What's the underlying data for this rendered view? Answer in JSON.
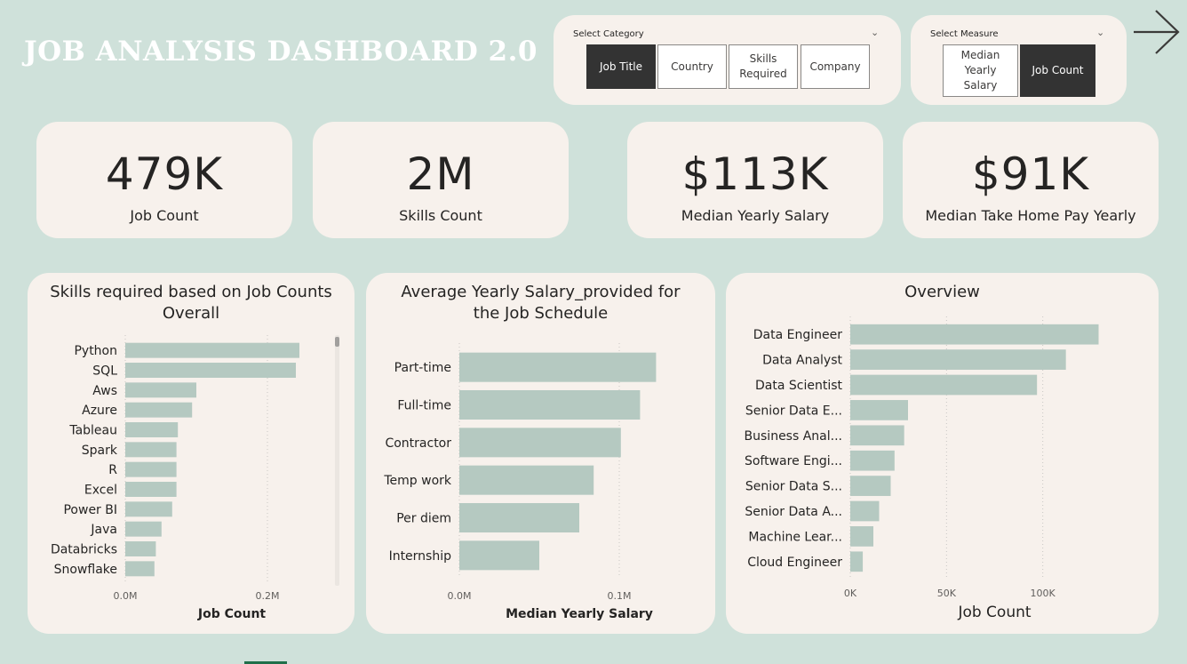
{
  "title": "JOB ANALYSIS DASHBOARD 2.0",
  "category_slicer": {
    "label": "Select Category",
    "options": [
      {
        "label": "Job Title",
        "selected": true
      },
      {
        "label": "Country",
        "selected": false
      },
      {
        "label": "Skills Required",
        "selected": false
      },
      {
        "label": "Company",
        "selected": false
      }
    ]
  },
  "measure_slicer": {
    "label": "Select Measure",
    "options": [
      {
        "label": "Median Yearly Salary",
        "selected": false
      },
      {
        "label": "Job Count",
        "selected": true
      }
    ]
  },
  "kpis": [
    {
      "value": "479K",
      "label": "Job Count"
    },
    {
      "value": "2M",
      "label": "Skills Count"
    },
    {
      "value": "$113K",
      "label": "Median Yearly Salary"
    },
    {
      "value": "$91K",
      "label": "Median Take Home Pay Yearly"
    }
  ],
  "colors": {
    "background": "#cfe1da",
    "card": "#f7f1ec",
    "bar": "#b5c9c1",
    "selected_tile": "#333333",
    "title_text": "#ffffff"
  },
  "chart_data": [
    {
      "type": "bar",
      "orientation": "horizontal",
      "title": "Skills required based on Job Counts Overall",
      "categories": [
        "Python",
        "SQL",
        "Aws",
        "Azure",
        "Tableau",
        "Spark",
        "R",
        "Excel",
        "Power BI",
        "Java",
        "Databricks",
        "Snowflake"
      ],
      "values": [
        245000,
        240000,
        100000,
        94000,
        74000,
        72000,
        72000,
        72000,
        66000,
        51000,
        43000,
        41000
      ],
      "xlabel": "Job Count",
      "ylabel": "",
      "xlim": [
        0,
        300000
      ],
      "xticks": [
        0,
        200000
      ],
      "xtick_labels": [
        "0.0M",
        "0.2M"
      ],
      "grid": true
    },
    {
      "type": "bar",
      "orientation": "horizontal",
      "title": "Average Yearly Salary_provided for the Job Schedule",
      "categories": [
        "Part-time",
        "Full-time",
        "Contractor",
        "Temp work",
        "Per diem",
        "Internship"
      ],
      "values": [
        123000,
        113000,
        101000,
        84000,
        75000,
        50000
      ],
      "xlabel": "Median Yearly Salary",
      "ylabel": "",
      "xlim": [
        0,
        150000
      ],
      "xticks": [
        0,
        100000
      ],
      "xtick_labels": [
        "0.0M",
        "0.1M"
      ],
      "grid": true
    },
    {
      "type": "bar",
      "orientation": "horizontal",
      "title": "Overview",
      "categories": [
        "Data Engineer",
        "Data Analyst",
        "Data Scientist",
        "Senior Data E...",
        "Business Anal...",
        "Software Engi...",
        "Senior Data S...",
        "Senior Data A...",
        "Machine Lear...",
        "Cloud Engineer"
      ],
      "values": [
        129000,
        112000,
        97000,
        30000,
        28000,
        23000,
        21000,
        15000,
        12000,
        6500
      ],
      "xlabel": "Job Count",
      "ylabel": "",
      "xlim": [
        0,
        150000
      ],
      "xticks": [
        0,
        50000,
        100000
      ],
      "xtick_labels": [
        "0K",
        "50K",
        "100K"
      ],
      "grid": true
    }
  ]
}
